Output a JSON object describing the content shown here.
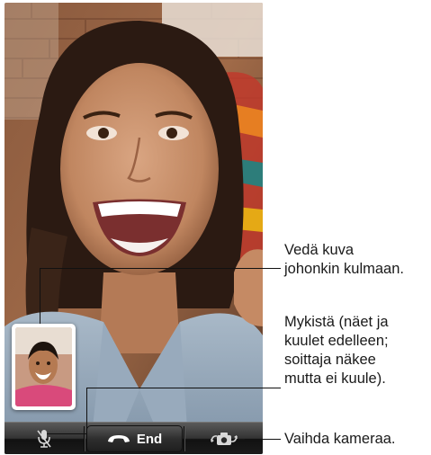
{
  "toolbar": {
    "mute_icon": "mic-mute-icon",
    "end_icon": "phone-hangup-icon",
    "end_label": "End",
    "switch_icon": "camera-switch-icon"
  },
  "callouts": {
    "drag_pip": "Vedä kuva\njohonkin kulmaan.",
    "mute": "Mykistä (näet ja\nkuulet edelleen;\nsoittaja näkee\nmutta ei kuule).",
    "switch_camera": "Vaihda kameraa."
  },
  "colors": {
    "toolbar": "#2a2a2a",
    "end_button": "#2e2e2e",
    "callout_line": "#111111",
    "callout_text": "#1a1a1a"
  }
}
